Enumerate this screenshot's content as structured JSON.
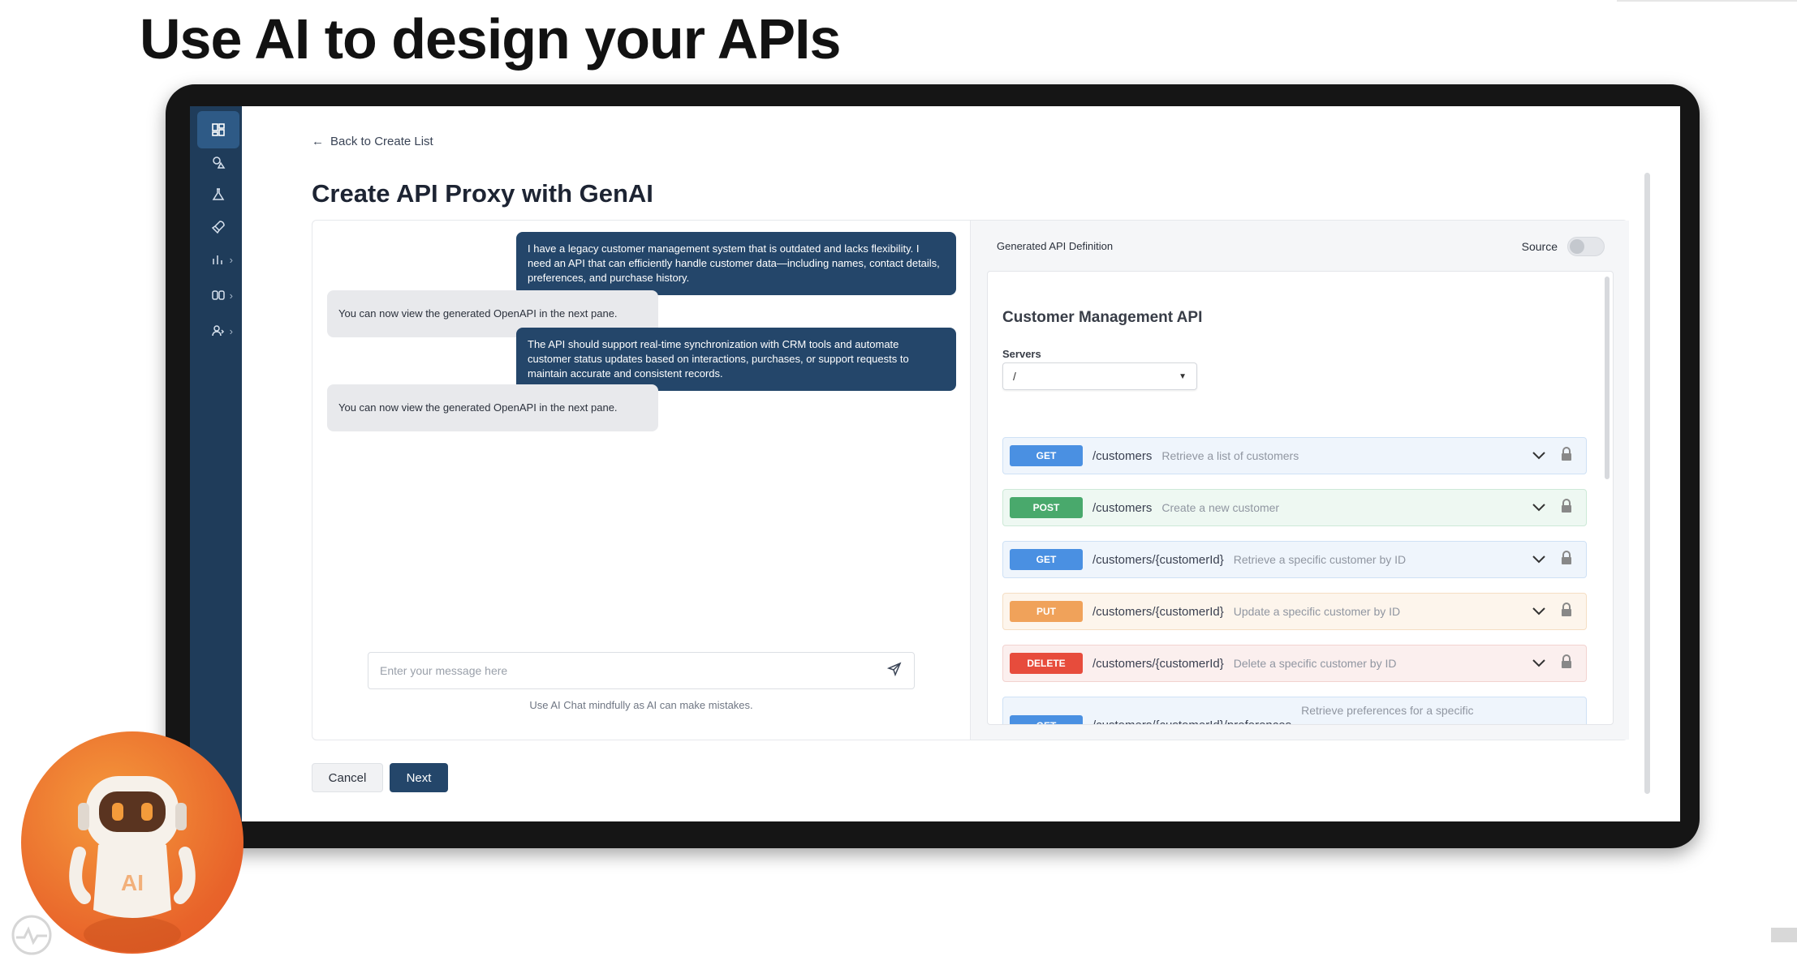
{
  "headline": "Use AI to design your APIs",
  "back_link": "Back to Create List",
  "page_title": "Create API Proxy with GenAI",
  "chat": {
    "messages": [
      {
        "role": "user",
        "text": "I have a legacy customer management system that is outdated and lacks flexibility. I need an API that can efficiently handle customer data—including names, contact details, preferences, and purchase history."
      },
      {
        "role": "ai",
        "text": "You can now view the generated OpenAPI in the next pane."
      },
      {
        "role": "user",
        "text": "The API should support real-time synchronization with CRM tools and automate customer status updates based on interactions, purchases, or support requests to maintain accurate and consistent records."
      },
      {
        "role": "ai",
        "text": "You can now view the generated OpenAPI in the next pane."
      }
    ],
    "input_placeholder": "Enter your message here",
    "disclaimer": "Use AI Chat mindfully as AI can make mistakes."
  },
  "definition": {
    "title": "Generated API Definition",
    "source_label": "Source",
    "source_enabled": false,
    "api_title": "Customer Management API",
    "servers_label": "Servers",
    "server_selected": "/",
    "operations": [
      {
        "method": "GET",
        "path": "/customers",
        "desc": "Retrieve a list of customers"
      },
      {
        "method": "POST",
        "path": "/customers",
        "desc": "Create a new customer"
      },
      {
        "method": "GET",
        "path": "/customers/{customerId}",
        "desc": "Retrieve a specific customer by ID"
      },
      {
        "method": "PUT",
        "path": "/customers/{customerId}",
        "desc": "Update a specific customer by ID"
      },
      {
        "method": "DELETE",
        "path": "/customers/{customerId}",
        "desc": "Delete a specific customer by ID"
      },
      {
        "method": "GET",
        "path": "/customers/{customerId}/preferences",
        "desc": "Retrieve preferences for a specific"
      }
    ]
  },
  "buttons": {
    "cancel": "Cancel",
    "next": "Next"
  },
  "robot_label": "AI",
  "colors": {
    "sidebar": "#1f3c5a",
    "user_bubble": "#24466a",
    "get": "#4a90e2",
    "post": "#49a96c",
    "put": "#f0a25a",
    "delete": "#e74c3c",
    "robot_orange": "#e8632a"
  }
}
